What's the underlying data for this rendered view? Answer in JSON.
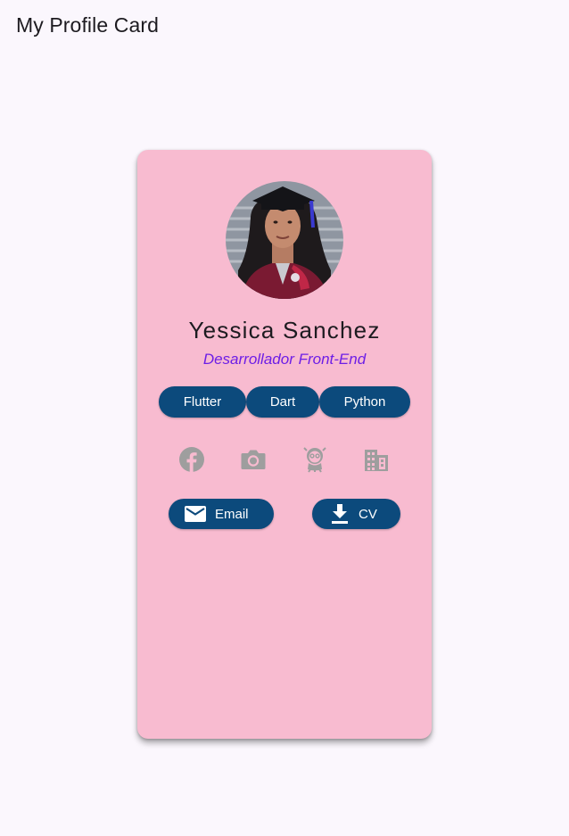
{
  "app_bar": {
    "title": "My Profile Card"
  },
  "profile": {
    "name": "Yessica Sanchez",
    "role": "Desarrollador Front-End",
    "avatar_icon": "profile-photo"
  },
  "skills": [
    {
      "label": "Flutter"
    },
    {
      "label": "Dart"
    },
    {
      "label": "Python"
    }
  ],
  "social_links": [
    {
      "icon": "facebook-icon"
    },
    {
      "icon": "camera-icon"
    },
    {
      "icon": "github-octocat-icon"
    },
    {
      "icon": "building-icon"
    }
  ],
  "actions": {
    "email_label": "Email",
    "email_icon": "mail-icon",
    "cv_label": "CV",
    "cv_icon": "download-icon"
  },
  "colors": {
    "page_background": "#fbf7fd",
    "card_background": "#f8bbd0",
    "button_background": "#0c4a7c",
    "role_text": "#6d1ee6",
    "social_icon": "#9e9e9e"
  }
}
